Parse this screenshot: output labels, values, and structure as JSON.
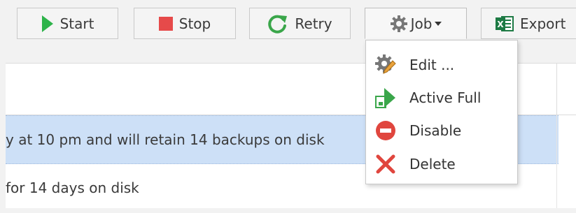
{
  "toolbar": {
    "start_label": "Start",
    "stop_label": "Stop",
    "retry_label": "Retry",
    "job_label": "Job",
    "export_label": "Export"
  },
  "job_menu": {
    "items": [
      {
        "label": "Edit ...",
        "icon": "gear-pencil-icon"
      },
      {
        "label": "Active Full",
        "icon": "active-full-icon"
      },
      {
        "label": "Disable",
        "icon": "disable-icon"
      },
      {
        "label": "Delete",
        "icon": "delete-icon"
      }
    ]
  },
  "grid": {
    "rows": [
      {
        "text": "y at 10 pm and will retain 14 backups on disk",
        "selected": true
      },
      {
        "text": "for 14 days on disk",
        "selected": false
      }
    ]
  },
  "colors": {
    "start_green": "#2db34a",
    "stop_red": "#e64a4a",
    "retry_green": "#3aa64a",
    "excel_green": "#1d7a44",
    "selection_blue": "#cde0f7",
    "delete_red": "#e0463e"
  }
}
